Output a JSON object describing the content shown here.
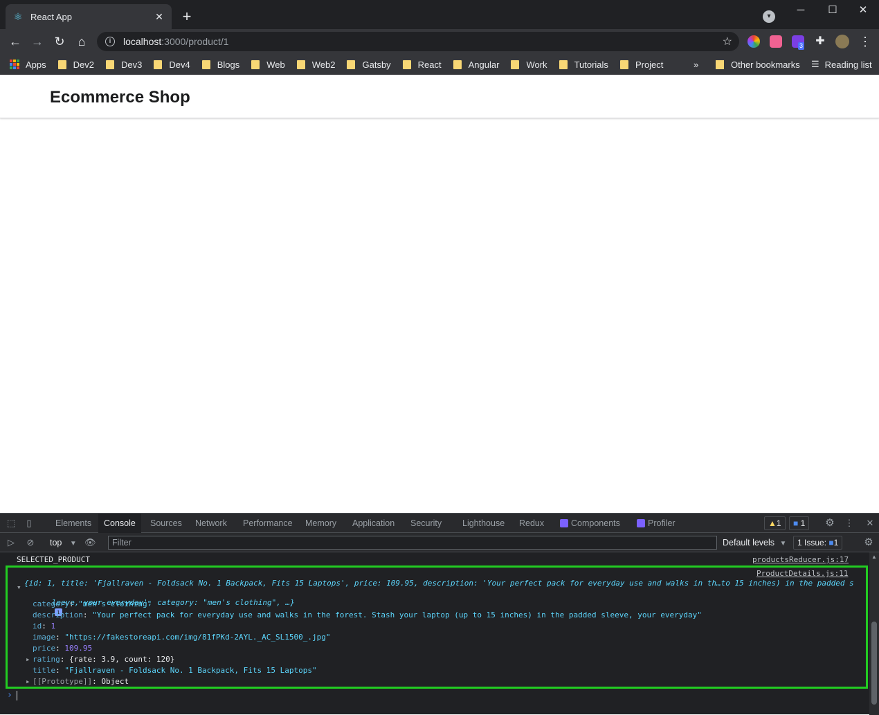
{
  "browser": {
    "tab_title": "React App",
    "url_host": "localhost",
    "url_path": ":3000/product/1",
    "extension_badge": "3"
  },
  "bookmarks": {
    "apps": "Apps",
    "items": [
      "Dev2",
      "Dev3",
      "Dev4",
      "Blogs",
      "Web",
      "Web2",
      "Gatsby",
      "React",
      "Angular",
      "Work",
      "Tutorials",
      "Project"
    ],
    "overflow": "»",
    "other": "Other bookmarks",
    "reading_list": "Reading list"
  },
  "page": {
    "brand": "Ecommerce Shop"
  },
  "devtools": {
    "tabs": [
      "Elements",
      "Console",
      "Sources",
      "Network",
      "Performance",
      "Memory",
      "Application",
      "Security",
      "Lighthouse",
      "Redux",
      "Components",
      "Profiler"
    ],
    "active_tab": "Console",
    "warnings_count": "1",
    "messages_count": "1",
    "context": "top",
    "filter_placeholder": "Filter",
    "levels": "Default levels",
    "issues": "1 Issue:",
    "issues_count": "1"
  },
  "console": {
    "log1_text": "SELECTED_PRODUCT",
    "log1_source": "productsReducer.js:17",
    "log2_source": "ProductDetails.js:11",
    "preview_line1": "{id: 1, title: 'Fjallraven - Foldsack No. 1 Backpack, Fits 15 Laptops', price: 109.95, description: 'Your perfect pack for everyday use and walks in th…to 15 inches) in the padded s",
    "preview_line2": "leeve, your everyday', category: \"men's clothing\", …}",
    "props": [
      {
        "key": "category",
        "value": "\"men's clothing\"",
        "kind": "string"
      },
      {
        "key": "description",
        "value": "\"Your perfect pack for everyday use and walks in the forest. Stash your laptop (up to 15 inches) in the padded sleeve, your everyday\"",
        "kind": "string"
      },
      {
        "key": "id",
        "value": "1",
        "kind": "number"
      },
      {
        "key": "image",
        "value": "\"https://fakestoreapi.com/img/81fPKd-2AYL._AC_SL1500_.jpg\"",
        "kind": "string"
      },
      {
        "key": "price",
        "value": "109.95",
        "kind": "number"
      },
      {
        "key": "rating",
        "value": "{rate: 3.9, count: 120}",
        "kind": "object"
      },
      {
        "key": "title",
        "value": "\"Fjallraven - Foldsack No. 1 Backpack, Fits 15 Laptops\"",
        "kind": "string"
      },
      {
        "key": "[[Prototype]]",
        "value": "Object",
        "kind": "proto"
      }
    ],
    "prompt": "›"
  }
}
